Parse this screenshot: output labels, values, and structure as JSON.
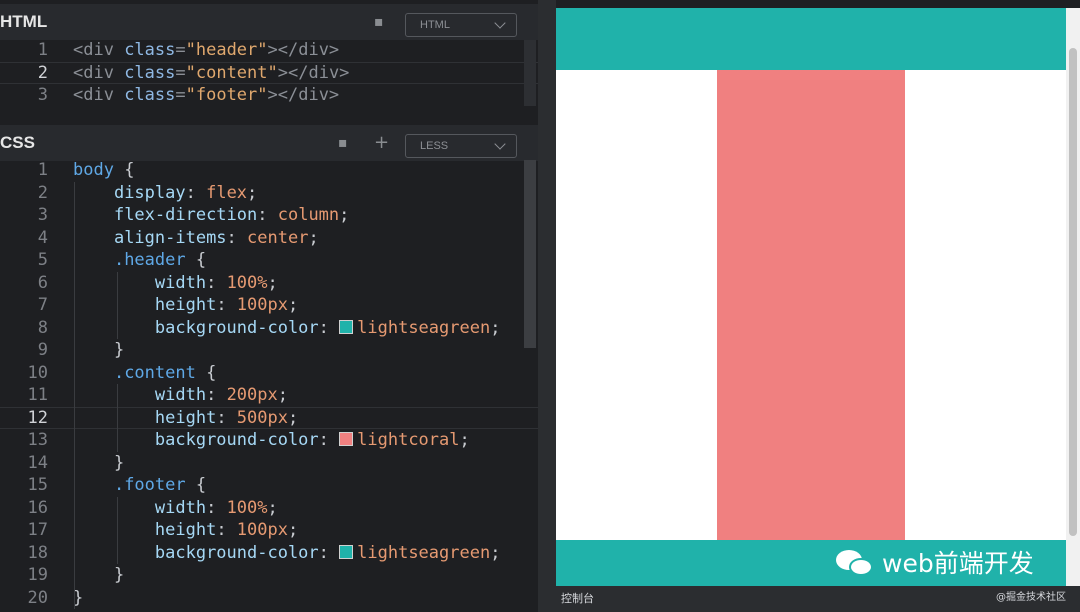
{
  "html_panel": {
    "title": "HTML",
    "mode": "HTML",
    "lines": [
      {
        "n": "1",
        "parts": [
          [
            "t-tag",
            "<div "
          ],
          [
            "t-kw",
            "class"
          ],
          [
            "t-tag",
            "="
          ],
          [
            "t-str",
            "\"header\""
          ],
          [
            "t-tag",
            "></div>"
          ]
        ]
      },
      {
        "n": "2",
        "parts": [
          [
            "t-tag",
            "<div "
          ],
          [
            "t-kw",
            "class"
          ],
          [
            "t-tag",
            "="
          ],
          [
            "t-str",
            "\"content\""
          ],
          [
            "t-tag",
            "><"
          ],
          [
            "t-tag",
            "/div>"
          ]
        ]
      },
      {
        "n": "3",
        "parts": [
          [
            "t-tag",
            "<div "
          ],
          [
            "t-kw",
            "class"
          ],
          [
            "t-tag",
            "="
          ],
          [
            "t-str",
            "\"footer\""
          ],
          [
            "t-tag",
            "></div>"
          ]
        ]
      }
    ]
  },
  "css_panel": {
    "title": "CSS",
    "mode": "LESS",
    "lines": [
      {
        "n": "1",
        "parts": [
          [
            "t-sel",
            "body "
          ],
          [
            "t-p",
            "{"
          ]
        ]
      },
      {
        "n": "2",
        "parts": [
          [
            "t-p",
            "    "
          ],
          [
            "t-prop",
            "display"
          ],
          [
            "t-p",
            ": "
          ],
          [
            "t-val",
            "flex"
          ],
          [
            "t-p",
            ";"
          ]
        ]
      },
      {
        "n": "3",
        "parts": [
          [
            "t-p",
            "    "
          ],
          [
            "t-prop",
            "flex-direction"
          ],
          [
            "t-p",
            ": "
          ],
          [
            "t-val",
            "column"
          ],
          [
            "t-p",
            ";"
          ]
        ]
      },
      {
        "n": "4",
        "parts": [
          [
            "t-p",
            "    "
          ],
          [
            "t-prop",
            "align-items"
          ],
          [
            "t-p",
            ": "
          ],
          [
            "t-val",
            "center"
          ],
          [
            "t-p",
            ";"
          ]
        ]
      },
      {
        "n": "5",
        "parts": [
          [
            "t-p",
            "    "
          ],
          [
            "t-sel",
            ".header "
          ],
          [
            "t-p",
            "{"
          ]
        ]
      },
      {
        "n": "6",
        "parts": [
          [
            "t-p",
            "        "
          ],
          [
            "t-prop",
            "width"
          ],
          [
            "t-p",
            ": "
          ],
          [
            "t-val",
            "100%"
          ],
          [
            "t-p",
            ";"
          ]
        ]
      },
      {
        "n": "7",
        "parts": [
          [
            "t-p",
            "        "
          ],
          [
            "t-prop",
            "height"
          ],
          [
            "t-p",
            ": "
          ],
          [
            "t-val",
            "100px"
          ],
          [
            "t-p",
            ";"
          ]
        ]
      },
      {
        "n": "8",
        "parts": [
          [
            "t-p",
            "        "
          ],
          [
            "t-prop",
            "background-color"
          ],
          [
            "t-p",
            ": "
          ],
          [
            "sw",
            "#20b2aa"
          ],
          [
            "t-val",
            "lightseagreen"
          ],
          [
            "t-p",
            ";"
          ]
        ]
      },
      {
        "n": "9",
        "parts": [
          [
            "t-p",
            "    }"
          ]
        ]
      },
      {
        "n": "10",
        "parts": [
          [
            "t-p",
            "    "
          ],
          [
            "t-sel",
            ".content "
          ],
          [
            "t-p",
            "{"
          ]
        ]
      },
      {
        "n": "11",
        "parts": [
          [
            "t-p",
            "        "
          ],
          [
            "t-prop",
            "width"
          ],
          [
            "t-p",
            ": "
          ],
          [
            "t-val",
            "200px"
          ],
          [
            "t-p",
            ";"
          ]
        ]
      },
      {
        "n": "12",
        "parts": [
          [
            "t-p",
            "        "
          ],
          [
            "t-prop",
            "height"
          ],
          [
            "t-p",
            ": "
          ],
          [
            "t-val",
            "500px"
          ],
          [
            "t-p",
            ";"
          ]
        ]
      },
      {
        "n": "13",
        "parts": [
          [
            "t-p",
            "        "
          ],
          [
            "t-prop",
            "background-color"
          ],
          [
            "t-p",
            ": "
          ],
          [
            "sw",
            "#f08080"
          ],
          [
            "t-val",
            "lightcoral"
          ],
          [
            "t-p",
            ";"
          ]
        ]
      },
      {
        "n": "14",
        "parts": [
          [
            "t-p",
            "    }"
          ]
        ]
      },
      {
        "n": "15",
        "parts": [
          [
            "t-p",
            "    "
          ],
          [
            "t-sel",
            ".footer "
          ],
          [
            "t-p",
            "{"
          ]
        ]
      },
      {
        "n": "16",
        "parts": [
          [
            "t-p",
            "        "
          ],
          [
            "t-prop",
            "width"
          ],
          [
            "t-p",
            ": "
          ],
          [
            "t-val",
            "100%"
          ],
          [
            "t-p",
            ";"
          ]
        ]
      },
      {
        "n": "17",
        "parts": [
          [
            "t-p",
            "        "
          ],
          [
            "t-prop",
            "height"
          ],
          [
            "t-p",
            ": "
          ],
          [
            "t-val",
            "100px"
          ],
          [
            "t-p",
            ";"
          ]
        ]
      },
      {
        "n": "18",
        "parts": [
          [
            "t-p",
            "        "
          ],
          [
            "t-prop",
            "background-color"
          ],
          [
            "t-p",
            ": "
          ],
          [
            "sw",
            "#20b2aa"
          ],
          [
            "t-val",
            "lightseagreen"
          ],
          [
            "t-p",
            ";"
          ]
        ]
      },
      {
        "n": "19",
        "parts": [
          [
            "t-p",
            "    }"
          ]
        ]
      },
      {
        "n": "20",
        "parts": [
          [
            "t-p",
            "}"
          ]
        ]
      }
    ]
  },
  "preview": {
    "header_color": "#20b2aa",
    "content_color": "#f08080",
    "footer_color": "#20b2aa",
    "watermark": "web前端开发"
  },
  "console_label": "控制台",
  "credit": "@掘金技术社区"
}
